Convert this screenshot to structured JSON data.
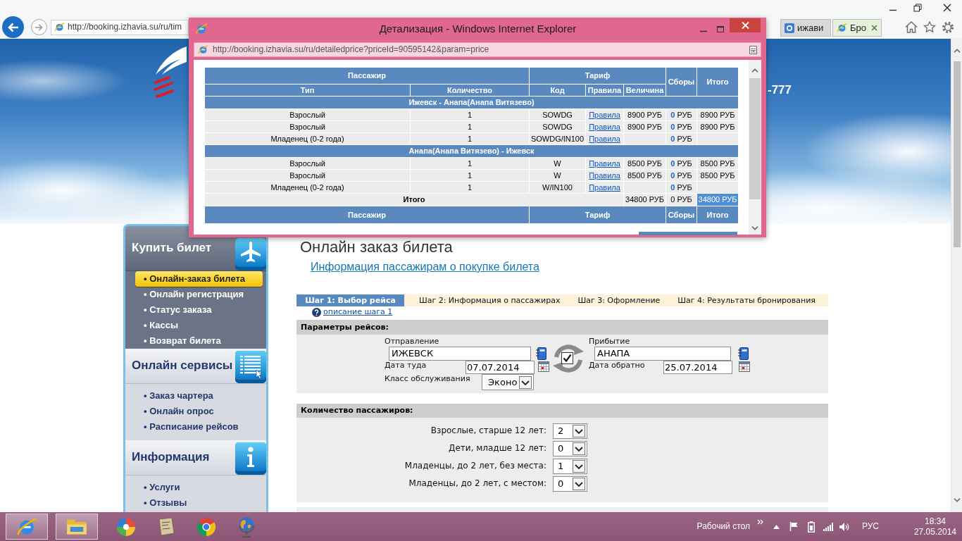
{
  "browser": {
    "address": "http://booking.izhavia.su/ru/tim",
    "tabs": [
      {
        "label": "ижави",
        "selected": false
      },
      {
        "label": "Бро",
        "selected": true
      }
    ]
  },
  "banner": {
    "phone": "-777"
  },
  "popup": {
    "title": "Детализация - Windows Internet Explorer",
    "address": "http://booking.izhavia.su/ru/detailedprice?priceId=90595142&param=price",
    "table": {
      "groups": [
        {
          "label": "Пассажир",
          "columns": [
            "Тип",
            "Количество"
          ]
        },
        {
          "label": "Тариф",
          "columns": [
            "Код",
            "Правила",
            "Величина"
          ]
        },
        {
          "label": "Сборы"
        },
        {
          "label": "Итого"
        }
      ],
      "sections": [
        {
          "route": "Ижевск - Анапа(Анапа Витязево)",
          "rows": [
            {
              "type": "Взрослый",
              "count": "1",
              "code": "SOWDG",
              "rules": "Правила",
              "amount": "8900 РУБ",
              "fee": "**0** РУБ",
              "total": "8900 РУБ"
            },
            {
              "type": "Взрослый",
              "count": "1",
              "code": "SOWDG",
              "rules": "Правила",
              "amount": "8900 РУБ",
              "fee": "**0** РУБ",
              "total": "8900 РУБ"
            },
            {
              "type": "Младенец (0-2 года)",
              "count": "1",
              "code": "SOWDG/IN100",
              "rules": "Правила",
              "fee": "**0** РУБ"
            }
          ]
        },
        {
          "route": "Анапа(Анапа Витязево) - Ижевск",
          "rows": [
            {
              "type": "Взрослый",
              "count": "1",
              "code": "W",
              "rules": "Правила",
              "amount": "8500 РУБ",
              "fee": "**0** РУБ",
              "total": "8500 РУБ"
            },
            {
              "type": "Взрослый",
              "count": "1",
              "code": "W",
              "rules": "Правила",
              "amount": "8500 РУБ",
              "fee": "**0** РУБ",
              "total": "8500 РУБ"
            },
            {
              "type": "Младенец (0-2 года)",
              "count": "1",
              "code": "W/IN100",
              "rules": "Правила",
              "fee": "**0** РУБ"
            }
          ]
        }
      ],
      "total": {
        "label": "Итого",
        "amount": "34800 РУБ",
        "fee": "0 РУБ",
        "value": "34800 РУБ",
        "selected": true
      },
      "footer": [
        "Пассажир",
        "Тариф",
        "Сборы",
        "Итого"
      ]
    }
  },
  "sidebar": [
    {
      "title": "Купить билет",
      "selected": true,
      "items": [
        {
          "label": "• Онлайн-заказ билета",
          "selected": true
        },
        {
          "label": "• Онлайн регистрация",
          "selected": false
        },
        {
          "label": "• Статус заказа",
          "selected": false
        },
        {
          "label": "• Кассы",
          "selected": false
        },
        {
          "label": "• Возврат билета",
          "selected": false
        }
      ]
    },
    {
      "title": "Онлайн сервисы",
      "selected": false,
      "items": [
        {
          "label": "• Заказ чартера",
          "selected": false
        },
        {
          "label": "• Онлайн опрос",
          "selected": false
        },
        {
          "label": "• Расписание рейсов",
          "selected": false
        }
      ]
    },
    {
      "title": "Информация",
      "selected": false,
      "items": [
        {
          "label": "• Услуги",
          "selected": false
        },
        {
          "label": "• Отзывы",
          "selected": false
        }
      ]
    }
  ],
  "main": {
    "heading": "Онлайн заказ билета",
    "info_link": "Информация пассажирам о покупке билета",
    "steps": [
      {
        "label": "Шаг 1: Выбор рейса",
        "selected": true
      },
      {
        "label": "Шаг 2: Информация о пассажирах",
        "selected": false
      },
      {
        "label": "Шаг 3: Оформление",
        "selected": false
      },
      {
        "label": "Шаг 4: Результаты бронирования",
        "selected": false
      }
    ],
    "step_help": "описание шага 1",
    "flights": {
      "title": "Параметры рейсов:",
      "departure": {
        "label": "Отправление",
        "value": "ИЖЕВСК"
      },
      "arrival": {
        "label": "Прибытие",
        "value": "АНАПА"
      },
      "return_trip": {
        "checked": true
      },
      "date_out": {
        "label": "Дата туда",
        "value": "07.07.2014"
      },
      "date_back": {
        "label": "Дата обратно",
        "value": "25.07.2014"
      },
      "service_class": {
        "label": "Класс обслуживания",
        "value": "Эконо"
      }
    },
    "passengers": {
      "title": "Количество пассажиров:",
      "rows": [
        {
          "label": "Взрослые, старше 12 лет:",
          "value": "2"
        },
        {
          "label": "Дети, младше 12 лет:",
          "value": "0"
        },
        {
          "label": "Младенцы, до 2 лет, без места:",
          "value": "1"
        },
        {
          "label": "Младенцы, до 2 лет, с местом:",
          "value": "0"
        }
      ]
    }
  },
  "taskbar": {
    "apps": [
      {
        "running": true
      },
      {
        "running": true
      },
      {
        "running": false
      },
      {
        "running": false
      },
      {
        "running": false
      },
      {
        "running": false
      }
    ],
    "desktop": "Рабочий стол",
    "language": "РУС",
    "time": "18:34",
    "date": "27.05.2014"
  }
}
